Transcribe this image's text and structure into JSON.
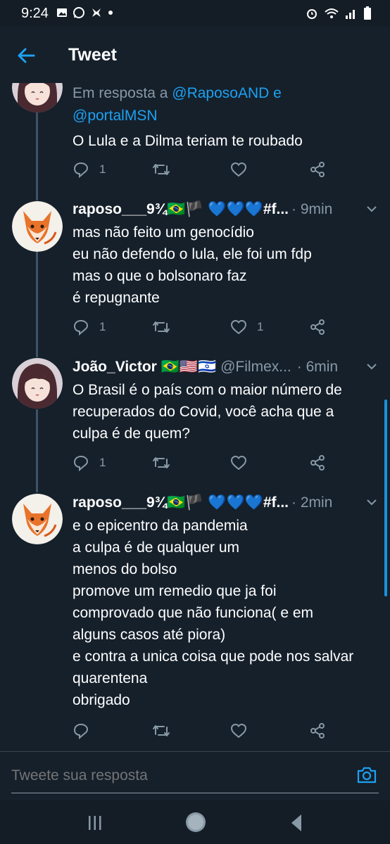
{
  "status_bar": {
    "time": "9:24"
  },
  "header": {
    "title": "Tweet"
  },
  "tweets": [
    {
      "reply_prefix": "Em resposta a",
      "reply_to_1": "@RaposoAND",
      "reply_join": "e",
      "reply_to_2": "@portalMSN",
      "lines": [
        "O Lula e a Dilma teriam te roubado"
      ],
      "replies": "1",
      "retweets": "",
      "likes": ""
    },
    {
      "name": "raposo___9¾🇧🇷🏴 💙💙💙#f...",
      "time": "· 9min",
      "lines": [
        "mas não feito um genocídio",
        "eu não defendo o lula, ele foi um fdp",
        "mas o que o bolsonaro faz",
        "é repugnante"
      ],
      "replies": "1",
      "retweets": "",
      "likes": "1"
    },
    {
      "name": "João_Victor 🇧🇷🇺🇸🇮🇱",
      "handle": "@Filmex...",
      "time": "· 6min",
      "lines": [
        "O Brasil é o país com o maior número de",
        "recuperados do Covid, você acha que a",
        "culpa é de quem?"
      ],
      "replies": "1",
      "retweets": "",
      "likes": ""
    },
    {
      "name": "raposo___9¾🇧🇷🏴 💙💙💙#f...",
      "time": "· 2min",
      "lines": [
        "e o epicentro da pandemia",
        "a culpa é de qualquer um",
        "menos do bolso",
        "promove um remedio que ja foi",
        "comprovado que não funciona( e em",
        "alguns casos até piora)",
        "e contra a unica coisa que pode nos salvar",
        "quarentena",
        "obrigado"
      ],
      "replies": "",
      "retweets": "",
      "likes": ""
    }
  ],
  "compose": {
    "placeholder": "Tweete sua resposta"
  },
  "icons": {
    "back": "arrow-left-icon",
    "reply": "reply-icon",
    "retweet": "retweet-icon",
    "like": "heart-icon",
    "share": "share-icon",
    "camera": "camera-icon",
    "more": "chevron-down-icon"
  },
  "colors": {
    "background": "#15202b",
    "accent": "#1da1f2",
    "secondary_text": "#8899a6",
    "divider": "#38444d"
  }
}
